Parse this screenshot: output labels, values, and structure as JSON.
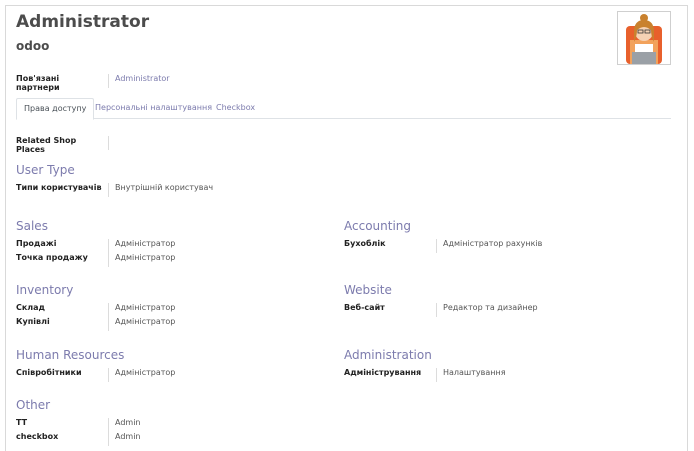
{
  "header": {
    "title": "Administrator",
    "login": "odoo"
  },
  "partner": {
    "label": "Пов'язані партнери",
    "value": "Administrator"
  },
  "tabs": [
    {
      "label": "Права доступу"
    },
    {
      "label": "Персональні налаштування"
    },
    {
      "label": "Checkbox"
    }
  ],
  "shop": {
    "label": "Related Shop Places",
    "value": ""
  },
  "user_type": {
    "title": "User Type",
    "label": "Типи користувачів",
    "value": "Внутрішній користувач"
  },
  "sales": {
    "title": "Sales",
    "rows": [
      {
        "label": "Продажі",
        "value": "Адміністратор"
      },
      {
        "label": "Точка продажу",
        "value": "Адміністратор"
      }
    ]
  },
  "accounting": {
    "title": "Accounting",
    "rows": [
      {
        "label": "Бухоблік",
        "value": "Адміністратор рахунків"
      }
    ]
  },
  "inventory": {
    "title": "Inventory",
    "rows": [
      {
        "label": "Склад",
        "value": "Адміністратор"
      },
      {
        "label": "Купівлі",
        "value": "Адміністратор"
      }
    ]
  },
  "website": {
    "title": "Website",
    "rows": [
      {
        "label": "Веб-сайт",
        "value": "Редактор та дизайнер"
      }
    ]
  },
  "hr": {
    "title": "Human Resources",
    "rows": [
      {
        "label": "Співробітники",
        "value": "Адміністратор"
      }
    ]
  },
  "administration": {
    "title": "Administration",
    "rows": [
      {
        "label": "Адміністрування",
        "value": "Налаштування"
      }
    ]
  },
  "other": {
    "title": "Other",
    "rows": [
      {
        "label": "TT",
        "value": "Admin"
      },
      {
        "label": "checkbox",
        "value": "Admin"
      }
    ]
  },
  "colors": {
    "accent": "#7c7bad",
    "text": "#4c4c4c"
  }
}
